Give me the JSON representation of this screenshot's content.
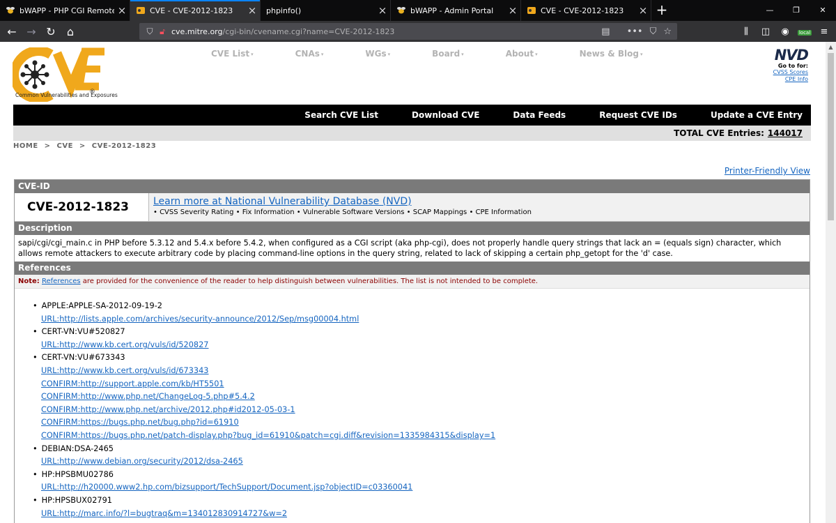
{
  "browser": {
    "tabs": [
      {
        "label": "bWAPP - PHP CGI Remote Code",
        "active": false
      },
      {
        "label": "CVE - CVE-2012-1823",
        "active": true
      },
      {
        "label": "phpinfo()",
        "active": false
      },
      {
        "label": "bWAPP - Admin Portal",
        "active": false
      },
      {
        "label": "CVE - CVE-2012-1823",
        "active": false
      }
    ],
    "url_domain": "cve.mitre.org",
    "url_path": "/cgi-bin/cvename.cgi?name=CVE-2012-1823",
    "local_badge": "local"
  },
  "site": {
    "logo_caption": "Common Vulnerabilities and Exposures",
    "nav": [
      "CVE List",
      "CNAs",
      "WGs",
      "Board",
      "About",
      "News & Blog"
    ],
    "nvd": {
      "logo": "NVD",
      "goto": "Go to for:",
      "links": [
        "CVSS Scores",
        "CPE Info"
      ]
    },
    "blackbar": [
      "Search CVE List",
      "Download CVE",
      "Data Feeds",
      "Request CVE IDs",
      "Update a CVE Entry"
    ],
    "total_label": "TOTAL CVE Entries:",
    "total_count": "144017",
    "breadcrumb": [
      "HOME",
      ">",
      "CVE",
      ">",
      "CVE-2012-1823"
    ],
    "printer_link": "Printer-Friendly View"
  },
  "entry": {
    "id_header": "CVE-ID",
    "id": "CVE-2012-1823",
    "nvd_link": "Learn more at National Vulnerability Database (NVD)",
    "nvd_sub": "• CVSS Severity Rating • Fix Information • Vulnerable Software Versions • SCAP Mappings • CPE Information",
    "desc_header": "Description",
    "description": "sapi/cgi/cgi_main.c in PHP before 5.3.12 and 5.4.x before 5.4.2, when configured as a CGI script (aka php-cgi), does not properly handle query strings that lack an = (equals sign) character, which allows remote attackers to execute arbitrary code by placing command-line options in the query string, related to lack of skipping a certain php_getopt for the 'd' case.",
    "ref_header": "References",
    "note_label": "Note:",
    "note_link": "References",
    "note_text": " are provided for the convenience of the reader to help distinguish between vulnerabilities. The list is not intended to be complete.",
    "references": [
      {
        "kind": "src",
        "text": "APPLE:APPLE-SA-2012-09-19-2"
      },
      {
        "kind": "lnk",
        "text": "URL:http://lists.apple.com/archives/security-announce/2012/Sep/msg00004.html"
      },
      {
        "kind": "src",
        "text": "CERT-VN:VU#520827"
      },
      {
        "kind": "lnk",
        "text": "URL:http://www.kb.cert.org/vuls/id/520827"
      },
      {
        "kind": "src",
        "text": "CERT-VN:VU#673343"
      },
      {
        "kind": "lnk",
        "text": "URL:http://www.kb.cert.org/vuls/id/673343"
      },
      {
        "kind": "lnk",
        "text": "CONFIRM:http://support.apple.com/kb/HT5501"
      },
      {
        "kind": "lnk",
        "text": "CONFIRM:http://www.php.net/ChangeLog-5.php#5.4.2"
      },
      {
        "kind": "lnk",
        "text": "CONFIRM:http://www.php.net/archive/2012.php#id2012-05-03-1"
      },
      {
        "kind": "lnk",
        "text": "CONFIRM:https://bugs.php.net/bug.php?id=61910"
      },
      {
        "kind": "lnk",
        "text": "CONFIRM:https://bugs.php.net/patch-display.php?bug_id=61910&patch=cgi.diff&revision=1335984315&display=1"
      },
      {
        "kind": "src",
        "text": "DEBIAN:DSA-2465"
      },
      {
        "kind": "lnk",
        "text": "URL:http://www.debian.org/security/2012/dsa-2465"
      },
      {
        "kind": "src",
        "text": "HP:HPSBMU02786"
      },
      {
        "kind": "lnk",
        "text": "URL:http://h20000.www2.hp.com/bizsupport/TechSupport/Document.jsp?objectID=c03360041"
      },
      {
        "kind": "src",
        "text": "HP:HPSBUX02791"
      },
      {
        "kind": "lnk",
        "text": "URL:http://marc.info/?l=bugtraq&m=134012830914727&w=2"
      }
    ]
  },
  "colors": {
    "link": "#1565c0",
    "header_bg": "#7a7a7a",
    "note": "#8b0000",
    "logo_orange": "#f0a81c"
  }
}
